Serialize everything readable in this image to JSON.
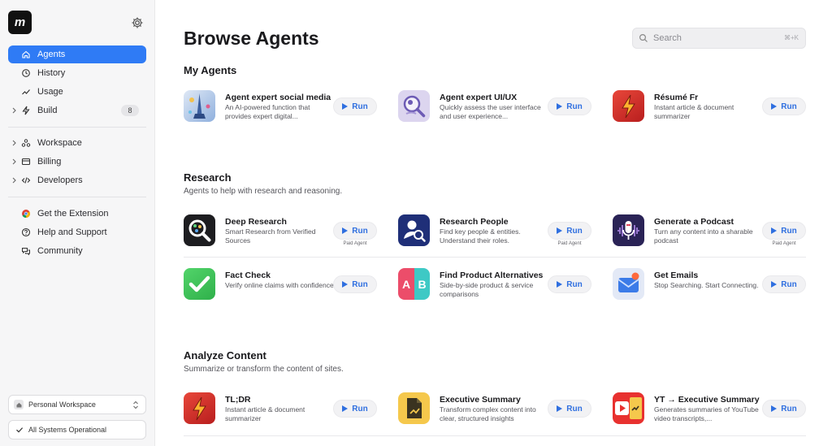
{
  "sidebar": {
    "logo_text": "m",
    "nav": [
      {
        "label": "Agents",
        "active": true
      },
      {
        "label": "History"
      },
      {
        "label": "Usage"
      },
      {
        "label": "Build",
        "badge": "8"
      },
      {
        "label": "Workspace"
      },
      {
        "label": "Billing"
      },
      {
        "label": "Developers"
      },
      {
        "label": "Get the Extension"
      },
      {
        "label": "Help and Support"
      },
      {
        "label": "Community"
      }
    ],
    "workspace_label": "Personal Workspace",
    "status_label": "All Systems Operational"
  },
  "header": {
    "title": "Browse Agents",
    "search_placeholder": "Search",
    "search_shortcut": "⌘+K"
  },
  "sections": {
    "my_agents": {
      "title": "My Agents"
    },
    "research": {
      "title": "Research",
      "subtitle": "Agents to help with research and reasoning."
    },
    "analyze": {
      "title": "Analyze Content",
      "subtitle": "Summarize or transform the content of sites."
    }
  },
  "run_label": "Run",
  "paid_label": "Paid Agent",
  "cards": {
    "social": {
      "name": "Agent expert social media",
      "desc": "An AI-powered function that provides expert digital..."
    },
    "uiux": {
      "name": "Agent expert UI/UX",
      "desc": "Quickly assess the user interface and user experience..."
    },
    "resume": {
      "name": "Résumé Fr",
      "desc": "Instant article & document summarizer"
    },
    "deep": {
      "name": "Deep Research",
      "desc": "Smart Research from Verified Sources"
    },
    "people": {
      "name": "Research People",
      "desc": "Find key people & entities. Understand their roles."
    },
    "podcast": {
      "name": "Generate a Podcast",
      "desc": "Turn any content into a sharable podcast"
    },
    "fact": {
      "name": "Fact Check",
      "desc": "Verify online claims with confidence"
    },
    "alternatives": {
      "name": "Find Product Alternatives",
      "desc": "Side-by-side product & service comparisons",
      "icon_letters": [
        "A",
        "B"
      ]
    },
    "emails": {
      "name": "Get Emails",
      "desc": "Stop Searching. Start Connecting."
    },
    "tldr": {
      "name": "TL;DR",
      "desc": "Instant article & document summarizer"
    },
    "exec": {
      "name": "Executive Summary",
      "desc": "Transform complex content into clear, structured insights"
    },
    "yt": {
      "name": "YT → Executive Summary",
      "desc": "Generates summaries of YouTube video transcripts,..."
    }
  },
  "colors": {
    "accent": "#2f7bf5",
    "run_text": "#2f6fe0",
    "sidebar_bg": "#f6f6f7"
  }
}
